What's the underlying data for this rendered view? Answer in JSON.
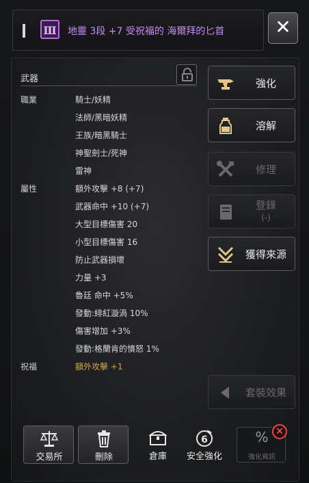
{
  "header": {
    "grade_badge": "Ⅲ",
    "item_title": "地靈 3段 +7 受祝福的 海爾拜的匕首",
    "close_label": "✕"
  },
  "details": {
    "section_label": "武器",
    "class_label": "職業",
    "classes": [
      "騎士/妖精",
      "法師/黑暗妖精",
      "王族/暗黑騎士",
      "神聖劍士/死神",
      "雷神"
    ],
    "attr_label": "屬性",
    "attributes": [
      "額外攻擊 +8 (+7)",
      "武器命中 +10 (+7)",
      "大型目標傷害 20",
      "小型目標傷害 16",
      "防止武器損壞",
      "力量 +3",
      "魯廷 命中 +5%",
      "發動:緋紅漩渦 10%",
      "傷害增加 +3%",
      "發動:格蘭肯的憤怒 1%"
    ],
    "blessing_label": "祝福",
    "blessing_value": "額外攻擊 +1"
  },
  "side_buttons": {
    "enhance": "強化",
    "dissolve": "溶解",
    "repair": "修理",
    "register_line1": "登錄",
    "register_line2": "(-)",
    "source": "獲得來源",
    "set_effect": "套裝效果"
  },
  "bottom_bar": {
    "exchange": "交易所",
    "delete": "刪除",
    "storage": "倉庫",
    "safe_enhance": "安全強化",
    "enhance_info_symbol": "%",
    "enhance_info_label": "強化資訊",
    "alert_badge": "✕"
  },
  "colors": {
    "title_purple": "#c28bf5",
    "blessing_gold": "#d2a64a",
    "alert_red": "#e24b4b"
  }
}
